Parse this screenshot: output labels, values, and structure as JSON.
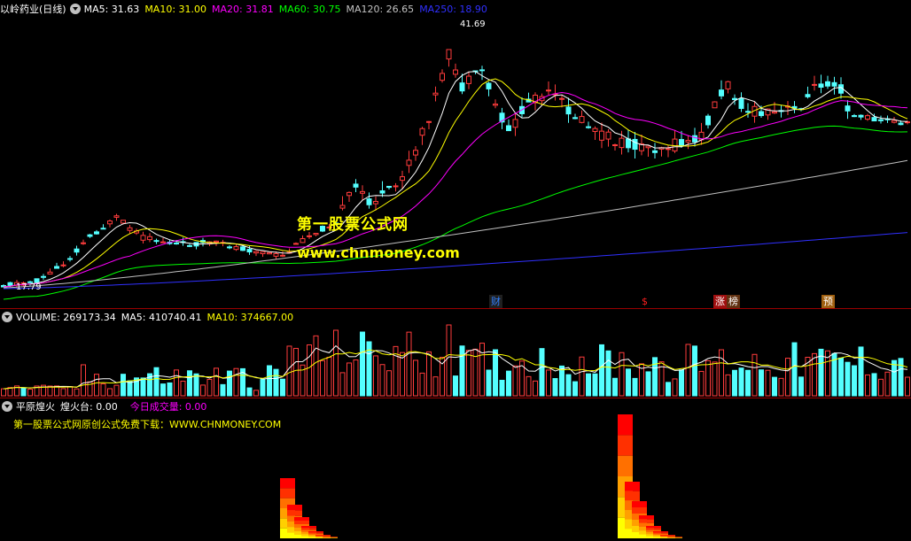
{
  "price_panel": {
    "stock_name": "以岭药业(日线)",
    "ma": [
      {
        "label": "MA5: 31.63",
        "color": "#ffffff"
      },
      {
        "label": "MA10: 31.00",
        "color": "#ffff00"
      },
      {
        "label": "MA20: 31.81",
        "color": "#ff00ff"
      },
      {
        "label": "MA60: 30.75",
        "color": "#00ff00"
      },
      {
        "label": "MA120: 26.65",
        "color": "#c0c0c0"
      },
      {
        "label": "MA250: 18.90",
        "color": "#3030ff"
      }
    ],
    "high_label": "41.69",
    "low_label": "17.79",
    "events": [
      {
        "text": "财",
        "color": "#3080ff",
        "bg": "#202020"
      },
      {
        "text": "$",
        "color": "#ff2020",
        "bg": "#000000"
      },
      {
        "text": "涨",
        "color": "#ffffff",
        "bg": "#a01010"
      },
      {
        "text": "榜",
        "color": "#ffffff",
        "bg": "#603010"
      },
      {
        "text": "预",
        "color": "#ffffff",
        "bg": "#a06010"
      }
    ]
  },
  "watermark": {
    "title": "第一股票公式网",
    "url": "www.chnmoney.com"
  },
  "volume_panel": {
    "title": "VOLUME: 269173.34",
    "ma5": "MA5: 410740.41",
    "ma10": "MA10: 374667.00"
  },
  "indicator_panel": {
    "name": "平原煌火",
    "line1": "煌火台: 0.00",
    "line2": "今日成交量: 0.00",
    "promo": "第一股票公式网原创公式免费下载：WWW.CHNMONEY.COM"
  },
  "colors": {
    "up": "#ff3c3c",
    "down": "#54ffff",
    "grid": "#9a0000"
  }
}
